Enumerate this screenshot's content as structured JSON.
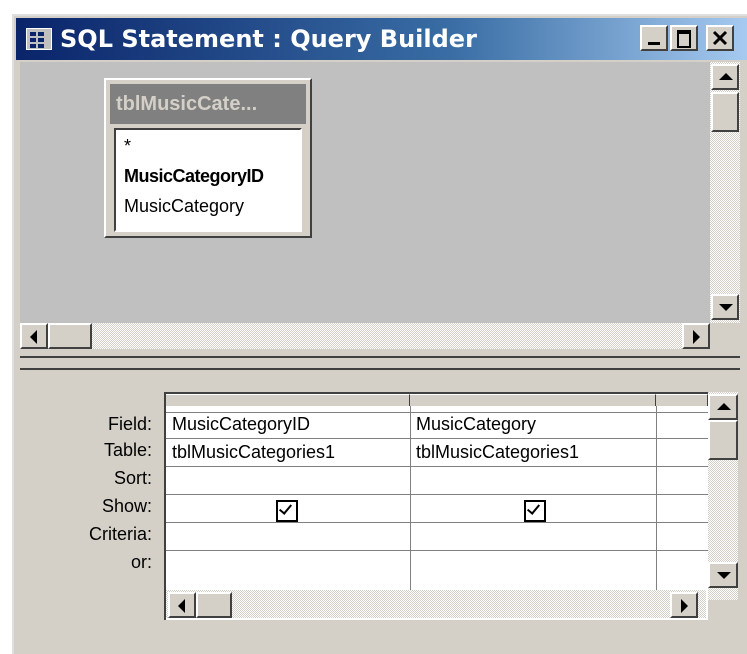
{
  "window": {
    "title": "SQL Statement : Query Builder"
  },
  "caption_buttons": [
    "minimize",
    "maximize",
    "close"
  ],
  "table_box": {
    "title": "tblMusicCate...",
    "fields": [
      "*",
      "MusicCategoryID",
      "MusicCategory"
    ],
    "bold_field": "MusicCategoryID"
  },
  "grid": {
    "row_labels": [
      "Field:",
      "Table:",
      "Sort:",
      "Show:",
      "Criteria:",
      "or:"
    ],
    "columns": [
      {
        "field": "MusicCategoryID",
        "table": "tblMusicCategories1",
        "sort": "",
        "show": true,
        "criteria": "",
        "or": ""
      },
      {
        "field": "MusicCategory",
        "table": "tblMusicCategories1",
        "sort": "",
        "show": true,
        "criteria": "",
        "or": ""
      }
    ]
  },
  "icons": {
    "app": "query-builder-icon",
    "minimize": "minimize-icon",
    "maximize": "maximize-icon",
    "close": "close-icon"
  },
  "colors": {
    "title_start": "#0a246a",
    "title_end": "#a6caf0",
    "face": "#d4d0c8",
    "diagram_bg": "#c0c0c0"
  }
}
